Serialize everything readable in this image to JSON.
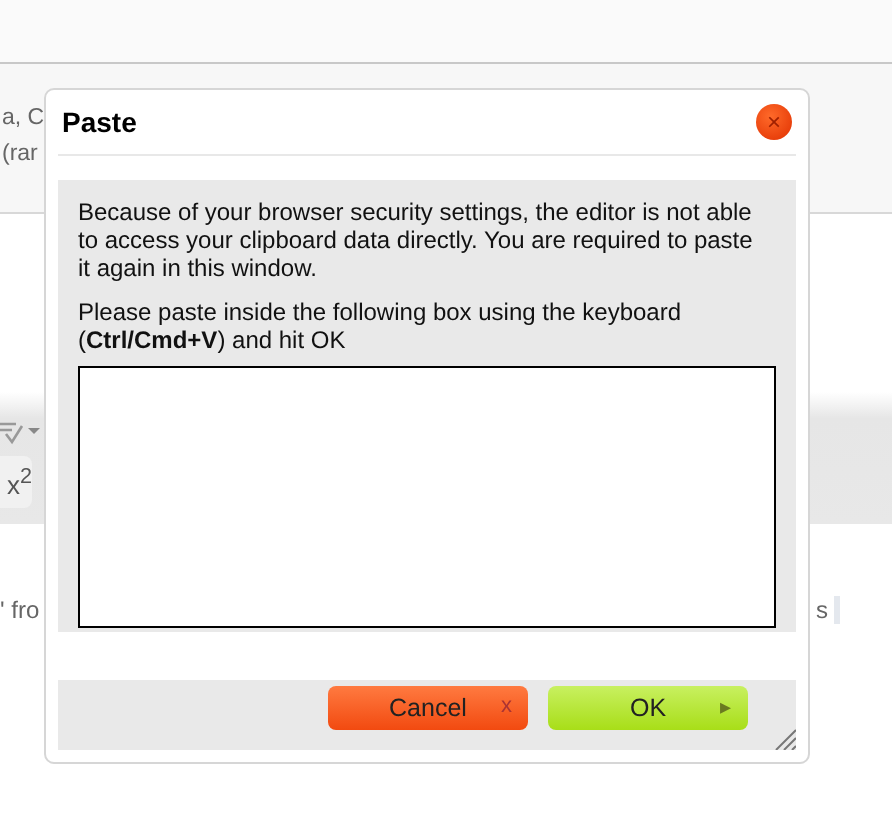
{
  "background": {
    "lines": [
      "a, C",
      "(rar"
    ],
    "toolbar": {
      "superscript_label": "x$^{2}$"
    },
    "body_text_left": "' fro",
    "body_text_right": "s"
  },
  "dialog": {
    "title": "Paste",
    "close": "×",
    "message": "Because of your browser security settings, the editor is not able to access your clipboard data directly. You are required to paste it again in this window.",
    "instruction": "Please paste inside the following box using the keyboard (**Ctrl/Cmd+V**) and hit OK",
    "buttons": [
      {
        "kind": "cancel",
        "label": "Cancel",
        "icon": "x"
      },
      {
        "kind": "ok",
        "label": "OK",
        "icon": "▸"
      }
    ]
  }
}
